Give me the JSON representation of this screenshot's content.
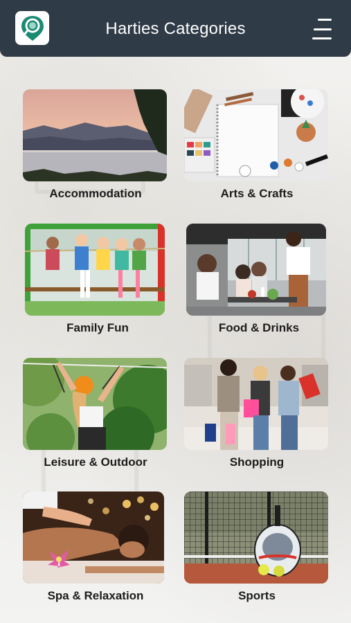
{
  "header": {
    "title": "Harties Categories",
    "logo_icon": "map-pin-magnifier-icon",
    "menu_icon": "hamburger-menu-icon",
    "bar_color": "#2f3b47",
    "logo_color": "#1b8a73"
  },
  "categories": [
    {
      "label": "Accommodation",
      "image": "lake-sunset-image"
    },
    {
      "label": "Arts & Crafts",
      "image": "art-supplies-image"
    },
    {
      "label": "Family Fun",
      "image": "kids-rope-course-image"
    },
    {
      "label": "Food & Drinks",
      "image": "restaurant-dining-image"
    },
    {
      "label": "Leisure & Outdoor",
      "image": "zipline-image"
    },
    {
      "label": "Shopping",
      "image": "shopping-friends-image"
    },
    {
      "label": "Spa & Relaxation",
      "image": "spa-massage-image"
    },
    {
      "label": "Sports",
      "image": "padel-racket-image"
    }
  ]
}
